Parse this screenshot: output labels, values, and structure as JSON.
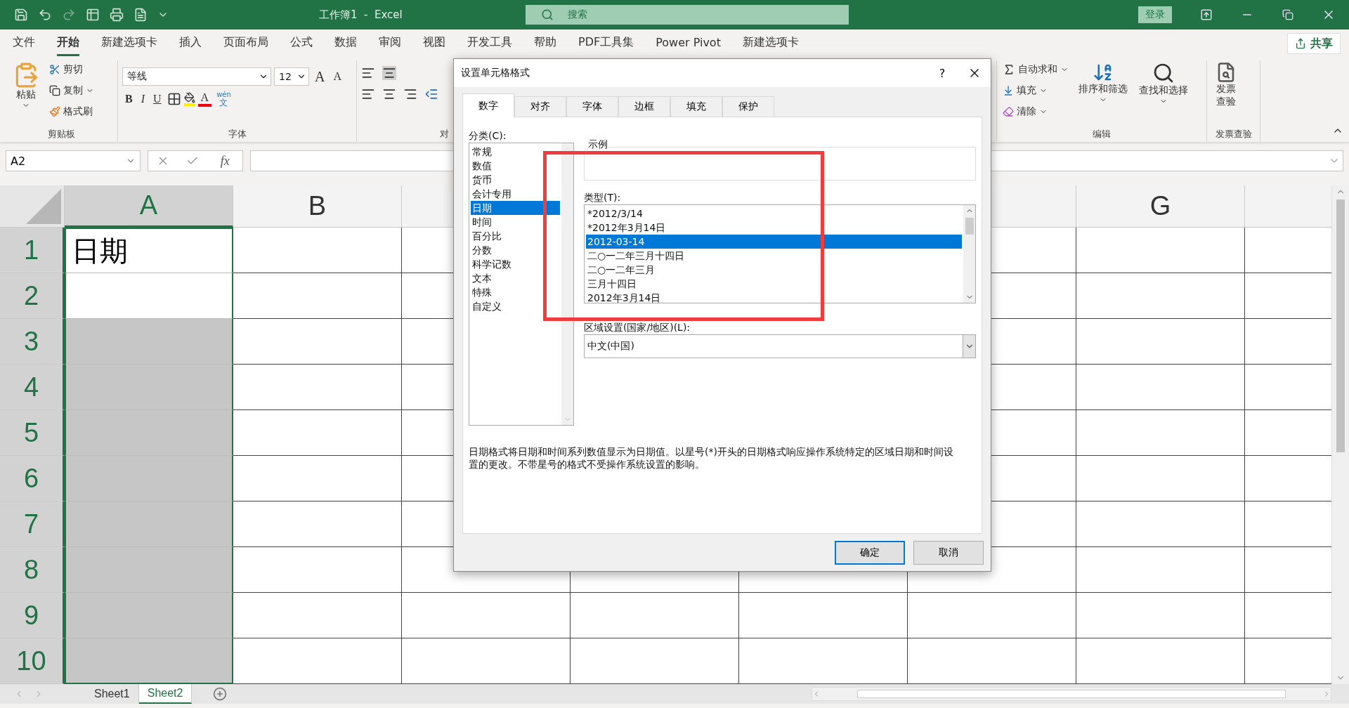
{
  "title_bar": {
    "title": "工作簿1  -  Excel",
    "search": {
      "placeholder": "搜索"
    },
    "sign_in": "登录"
  },
  "menu_tabs": [
    {
      "label": "文件",
      "selected": false
    },
    {
      "label": "开始",
      "selected": true
    },
    {
      "label": "新建选项卡",
      "selected": false
    },
    {
      "label": "插入",
      "selected": false
    },
    {
      "label": "页面布局",
      "selected": false
    },
    {
      "label": "公式",
      "selected": false
    },
    {
      "label": "数据",
      "selected": false
    },
    {
      "label": "审阅",
      "selected": false
    },
    {
      "label": "视图",
      "selected": false
    },
    {
      "label": "开发工具",
      "selected": false
    },
    {
      "label": "帮助",
      "selected": false
    },
    {
      "label": "PDF工具集",
      "selected": false
    },
    {
      "label": "Power Pivot",
      "selected": false
    },
    {
      "label": "新建选项卡",
      "selected": false
    }
  ],
  "share": "共享",
  "ribbon": {
    "clipboard": {
      "paste": "粘贴",
      "cut": "剪切",
      "copy": "复制",
      "format_painter": "格式刷",
      "label": "剪贴板"
    },
    "font": {
      "name": "等线",
      "size": "12",
      "grow": "A",
      "shrink": "A",
      "bold": "B",
      "italic": "I",
      "underline": "U",
      "font_color": "A",
      "phonetic_top": "wén",
      "phonetic_bottom": "文",
      "label": "字体"
    },
    "alignment": {
      "label": "对"
    },
    "editing": {
      "autosum": "自动求和",
      "fill": "填充",
      "clear": "清除",
      "sort_filter": "排序和筛选",
      "find_select": "查找和选择",
      "label": "编辑"
    },
    "invoice": {
      "button": "发票查验",
      "label": "发票查验"
    }
  },
  "formula_bar": {
    "name_box": "A2",
    "fx": "fx"
  },
  "sheet": {
    "columns": [
      {
        "label": "A",
        "selected": true
      },
      {
        "label": "B",
        "selected": false
      },
      {
        "label": "G",
        "selected": false
      }
    ],
    "rows": [
      {
        "header": "1",
        "selected": true,
        "cell_a": {
          "value": "日期",
          "shaded": false
        }
      },
      {
        "header": "2",
        "selected": true,
        "cell_a": {
          "shaded": false
        }
      },
      {
        "header": "3",
        "selected": true,
        "cell_a": {
          "shaded": true
        }
      },
      {
        "header": "4",
        "selected": true,
        "cell_a": {
          "shaded": true
        }
      },
      {
        "header": "5",
        "selected": true,
        "cell_a": {
          "shaded": true
        }
      },
      {
        "header": "6",
        "selected": true,
        "cell_a": {
          "shaded": true
        }
      },
      {
        "header": "7",
        "selected": true,
        "cell_a": {
          "shaded": true
        }
      },
      {
        "header": "8",
        "selected": true,
        "cell_a": {
          "shaded": true
        }
      },
      {
        "header": "9",
        "selected": true,
        "cell_a": {
          "shaded": true
        }
      },
      {
        "header": "10",
        "selected": true,
        "cell_a": {
          "shaded": true
        }
      }
    ]
  },
  "sheet_tabs": [
    {
      "label": "Sheet1",
      "selected": false
    },
    {
      "label": "Sheet2",
      "selected": true
    }
  ],
  "dialog": {
    "title": "设置单元格格式",
    "help": "?",
    "tabs": [
      {
        "label": "数字",
        "selected": true
      },
      {
        "label": "对齐",
        "selected": false
      },
      {
        "label": "字体",
        "selected": false
      },
      {
        "label": "边框",
        "selected": false
      },
      {
        "label": "填充",
        "selected": false
      },
      {
        "label": "保护",
        "selected": false
      }
    ],
    "category_label": "分类(C):",
    "categories": [
      {
        "label": "常规",
        "selected": false
      },
      {
        "label": "数值",
        "selected": false
      },
      {
        "label": "货币",
        "selected": false
      },
      {
        "label": "会计专用",
        "selected": false
      },
      {
        "label": "日期",
        "selected": true
      },
      {
        "label": "时间",
        "selected": false
      },
      {
        "label": "百分比",
        "selected": false
      },
      {
        "label": "分数",
        "selected": false
      },
      {
        "label": "科学记数",
        "selected": false
      },
      {
        "label": "文本",
        "selected": false
      },
      {
        "label": "特殊",
        "selected": false
      },
      {
        "label": "自定义",
        "selected": false
      }
    ],
    "sample_label": "示例",
    "type_label": "类型(T):",
    "types": [
      {
        "label": "*2012/3/14",
        "selected": false
      },
      {
        "label": "*2012年3月14日",
        "selected": false
      },
      {
        "label": "2012-03-14",
        "selected": true
      },
      {
        "label": "二○一二年三月十四日",
        "selected": false
      },
      {
        "label": "二○一二年三月",
        "selected": false
      },
      {
        "label": "三月十四日",
        "selected": false
      },
      {
        "label": "2012年3月14日",
        "selected": false
      }
    ],
    "locale_label": "区域设置(国家/地区)(L):",
    "locale": "中文(中国)",
    "description": "日期格式将日期和时间系列数值显示为日期值。以星号(*)开头的日期格式响应操作系统特定的区域日期和时间设置的更改。不带星号的格式不受操作系统设置的影响。",
    "ok": "确定",
    "cancel": "取消"
  }
}
